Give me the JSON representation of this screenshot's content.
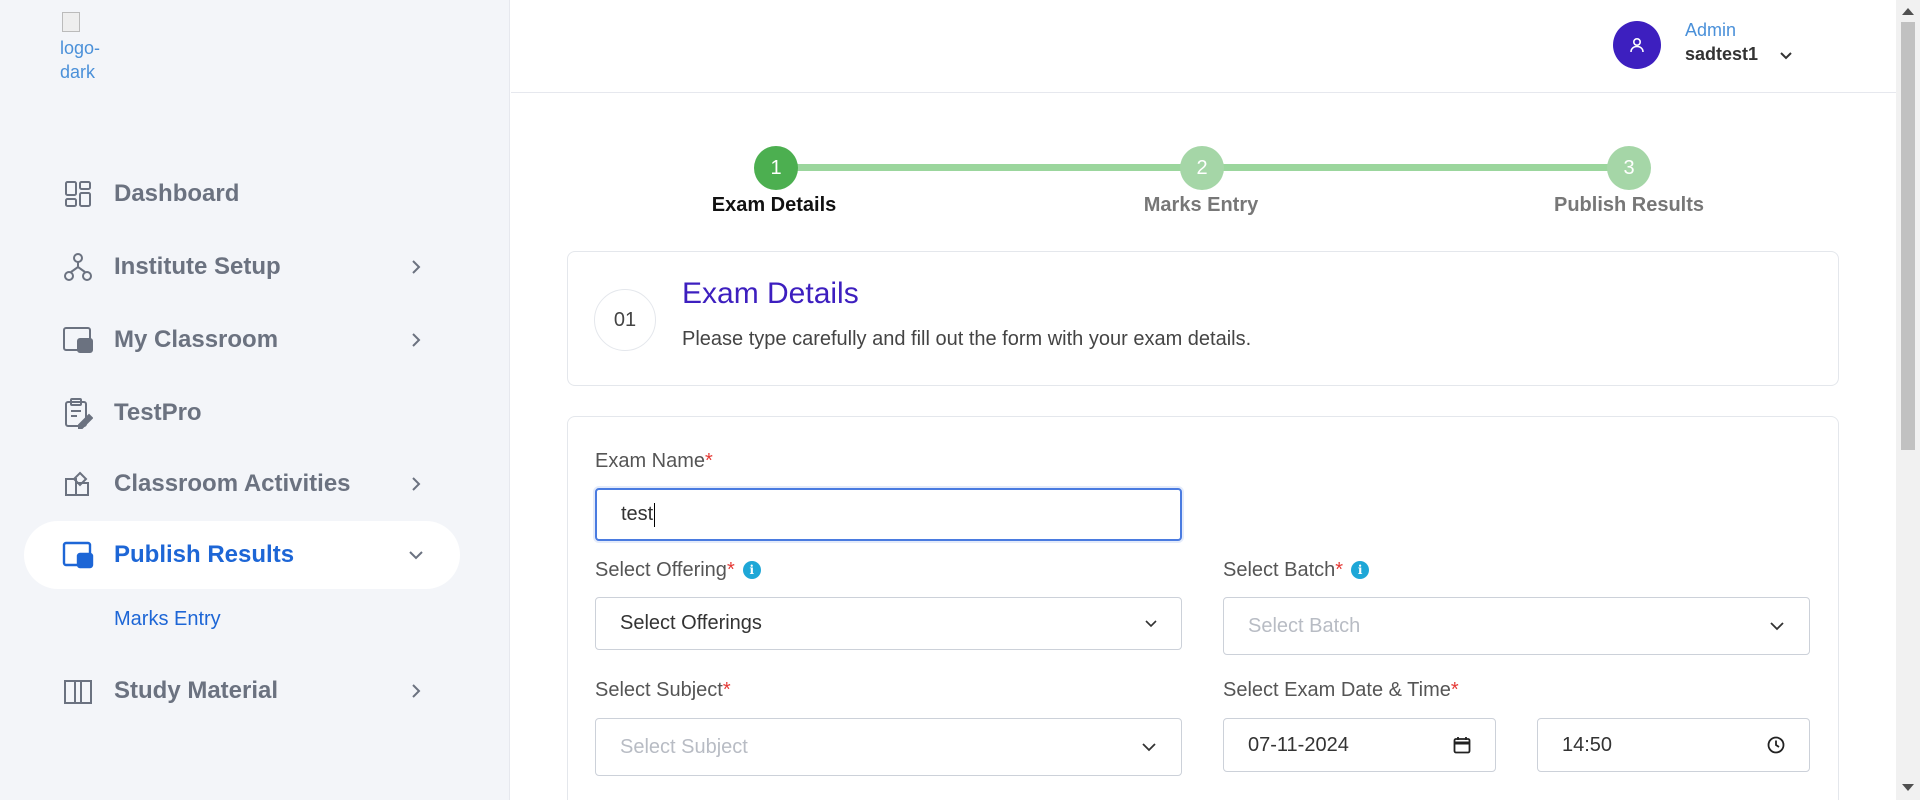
{
  "logo": {
    "alt_text": "logo-dark"
  },
  "sidebar": {
    "items": [
      {
        "label": "Dashboard",
        "icon": "dashboard-icon",
        "has_chevron": false
      },
      {
        "label": "Institute Setup",
        "icon": "hierarchy-icon",
        "has_chevron": true
      },
      {
        "label": "My Classroom",
        "icon": "classroom-icon",
        "has_chevron": true
      },
      {
        "label": "TestPro",
        "icon": "clipboard-pen-icon",
        "has_chevron": false
      },
      {
        "label": "Classroom Activities",
        "icon": "activities-icon",
        "has_chevron": true
      },
      {
        "label": "Publish Results",
        "icon": "publish-icon",
        "has_chevron": true,
        "active": true
      },
      {
        "label": "Study Material",
        "icon": "book-icon",
        "has_chevron": true
      }
    ],
    "sub_items": [
      {
        "label": "Marks Entry"
      }
    ]
  },
  "header": {
    "user_role": "Admin",
    "user_name": "sadtest1"
  },
  "stepper": {
    "steps": [
      {
        "number": "1",
        "label": "Exam Details",
        "state": "active"
      },
      {
        "number": "2",
        "label": "Marks Entry",
        "state": "pending"
      },
      {
        "number": "3",
        "label": "Publish Results",
        "state": "pending"
      }
    ],
    "colors": {
      "active": "#4caf50",
      "pending": "#a5d6a7",
      "line": "#9bd69d"
    }
  },
  "section": {
    "number": "01",
    "title": "Exam Details",
    "subtitle": "Please type carefully and fill out the form with your exam details."
  },
  "form": {
    "exam_name": {
      "label": "Exam Name",
      "required_mark": "*",
      "value": "test"
    },
    "offering": {
      "label": "Select Offering",
      "required_mark": "*",
      "value": "Select Offerings"
    },
    "batch": {
      "label": "Select Batch",
      "required_mark": "*",
      "placeholder": "Select Batch"
    },
    "subject": {
      "label": "Select Subject",
      "required_mark": "*",
      "placeholder": "Select Subject"
    },
    "exam_datetime": {
      "label": "Select Exam Date & Time",
      "required_mark": "*",
      "date": "07-11-2024",
      "time": "14:50"
    }
  },
  "colors": {
    "accent": "#1d66d6",
    "title": "#3d1fbf",
    "avatar": "#3d1fbf",
    "required": "#e53935",
    "info": "#1ea7d7"
  }
}
